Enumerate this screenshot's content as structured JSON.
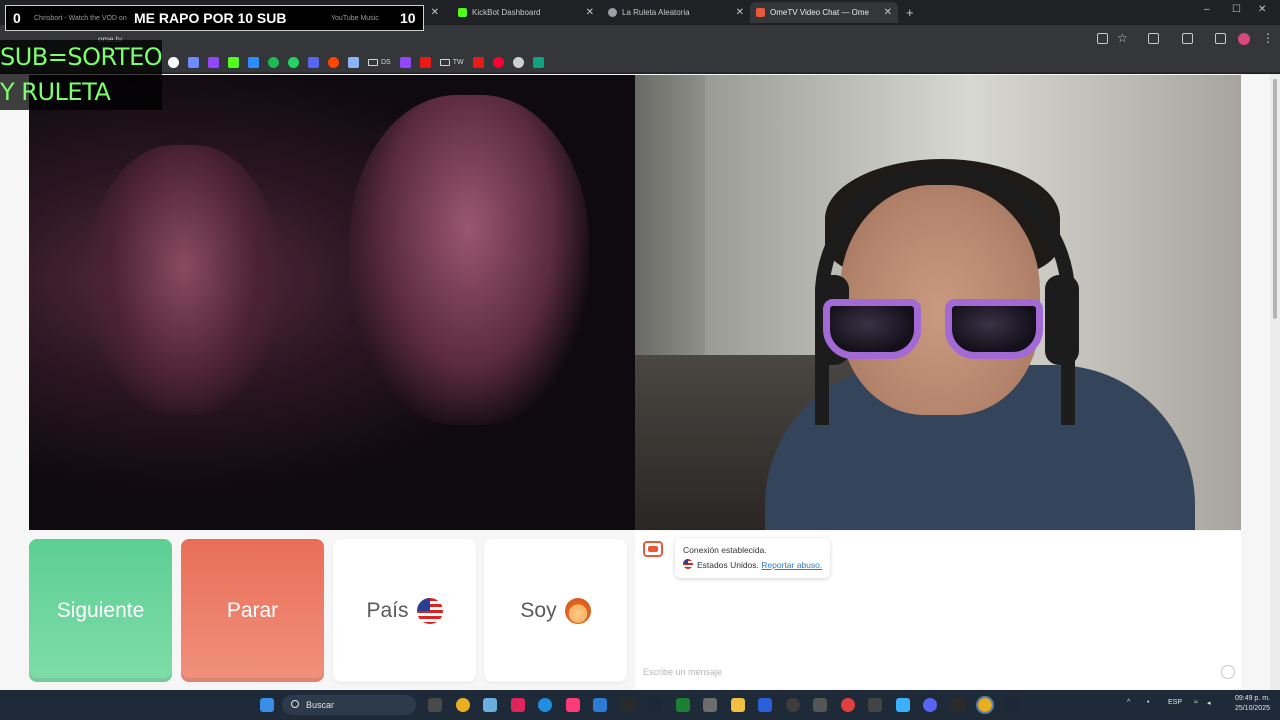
{
  "browser": {
    "tabs": [
      {
        "label": "Chrisbort - Watch the VOD on",
        "icon_color": "#53fc18"
      },
      {
        "label": "YouTube Music",
        "icon_color": "#ff0033"
      },
      {
        "label": "KickBot Dashboard",
        "icon_color": "#53fc18"
      },
      {
        "label": "La Ruleta Aleatoria",
        "icon_color": "#9aa0a6"
      },
      {
        "label": "OmeTV Video Chat — Ome",
        "icon_color": "#e85a3a"
      }
    ],
    "new_tab": "+",
    "url": "ome.tv",
    "bookmarks": [
      {
        "label": "DS"
      },
      {
        "label": "TW"
      }
    ]
  },
  "stream_overlay": {
    "left_number": "0",
    "title": "ME RAPO POR 10 SUB",
    "right_number": "10",
    "promo_line1": "SUB=SORTEO",
    "promo_line2": "Y RULETA"
  },
  "controls": {
    "next_label": "Siguiente",
    "stop_label": "Parar",
    "country_label": "País",
    "me_label": "Soy"
  },
  "chat": {
    "status": "Conexión establecida.",
    "country": "Estados Unidos.",
    "report_link": "Reportar abuso.",
    "input_placeholder": "Escribe un mensaje"
  },
  "taskbar": {
    "search_placeholder": "Buscar",
    "language": "ESP",
    "time": "09:49 p. m.",
    "date": "25/10/2025"
  },
  "colors": {
    "next_button": "#5ccf93",
    "stop_button": "#e96e58",
    "link": "#2f7bd3",
    "overlay_text": "#7cff6e"
  }
}
